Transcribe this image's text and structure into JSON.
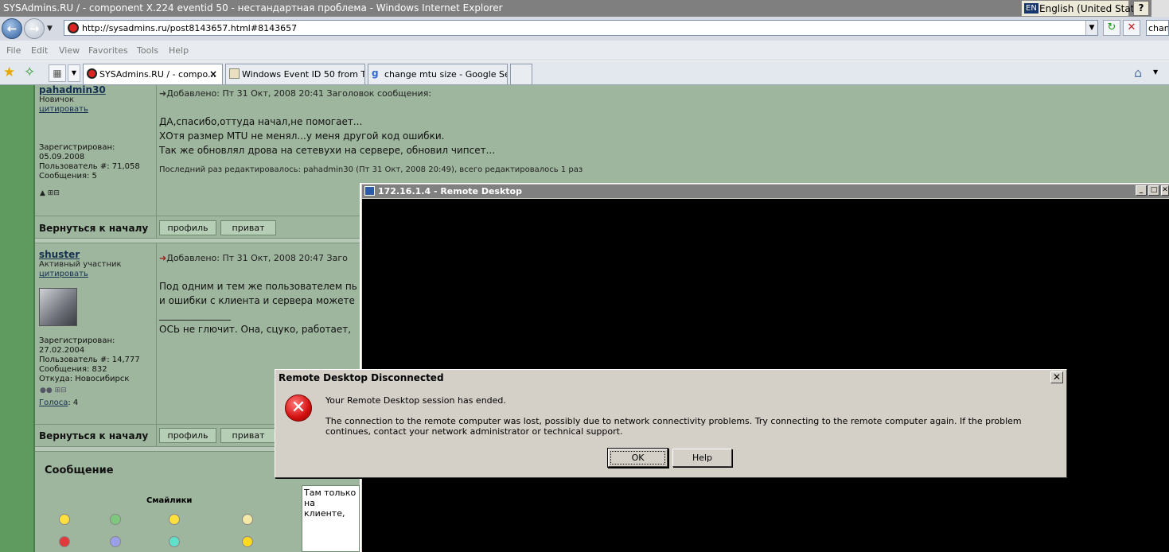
{
  "window": {
    "title": "SYSAdmins.RU / - component X.224 eventid 50 - нестандартная проблема - Windows Internet Explorer",
    "lang_code": "EN",
    "lang_label": "English (United States)",
    "help": "?"
  },
  "address": {
    "url": "http://sysadmins.ru/post8143657.html#8143657",
    "search_value": "chang"
  },
  "menu": [
    "File",
    "Edit",
    "View",
    "Favorites",
    "Tools",
    "Help"
  ],
  "tabs": [
    {
      "label": "SYSAdmins.RU / - compo...",
      "active": true
    },
    {
      "label": "Windows Event ID 50 from T...",
      "active": false
    },
    {
      "label": "change mtu size - Google Se...",
      "active": false
    }
  ],
  "tab_close": "×",
  "post1": {
    "user": "pahadmin30",
    "rank": "Новичок",
    "quote": "цитировать",
    "registered_label": "Зарегистрирован:",
    "registered": "05.09.2008",
    "user_no": "Пользователь #: 71,058",
    "messages": "Сообщения: 5",
    "header": "Добавлено: Пт 31 Окт, 2008 20:41    Заголовок сообщения:",
    "lines": [
      "ДА,спасибо,оттуда начал,не помогает...",
      "ХОтя размер MTU не менял...у меня другой код ошибки.",
      "Так же обновлял дрова на сетевухи на сервере, обновил чипсет..."
    ],
    "edit_note": "Последний раз редактировалось: pahadmin30 (Пт 31 Окт, 2008 20:49), всего редактировалось 1 раз"
  },
  "post2": {
    "user": "shuster",
    "rank": "Активный участник",
    "quote": "цитировать",
    "registered_label": "Зарегистрирован:",
    "registered": "27.02.2004",
    "user_no": "Пользователь #: 14,777",
    "messages": "Сообщения: 832",
    "from": "Откуда: Новосибирск",
    "votes_label": "Голоса",
    "votes": ": 4",
    "header": "Добавлено: Пт 31 Окт, 2008 20:47    Заго",
    "lines": [
      "Под одним и тем же пользователем пь",
      "и ошибки с клиента и сервера можете",
      "_______________",
      "ОСЬ не глючит. Она, сцуко, работает,"
    ]
  },
  "nav": {
    "back_to_top": "Вернуться к началу",
    "profile": "профиль",
    "private": "приват"
  },
  "reply": {
    "title": "Сообщение",
    "smilies": "Смайлики",
    "text_line1": "Там только",
    "text_line2": "на клиенте,"
  },
  "rdp": {
    "title": "172.16.1.4 - Remote Desktop"
  },
  "dialog": {
    "title": "Remote Desktop Disconnected",
    "message1": "Your Remote Desktop session has ended.",
    "message2": "The connection to the remote computer was lost, possibly due to network connectivity problems. Try connecting to the remote computer again. If the problem continues, contact your network administrator or technical support.",
    "ok": "OK",
    "help": "Help"
  },
  "colors": {
    "page_bg": "#9eb59e",
    "left_strip": "#5f9a5f",
    "title_inactive": "#808080",
    "error_red": "#d41010"
  },
  "icons": [
    "back-arrow-icon",
    "forward-arrow-icon",
    "refresh-icon",
    "stop-icon",
    "favorites-star-icon",
    "add-favorite-icon",
    "home-icon",
    "error-icon",
    "close-icon"
  ]
}
